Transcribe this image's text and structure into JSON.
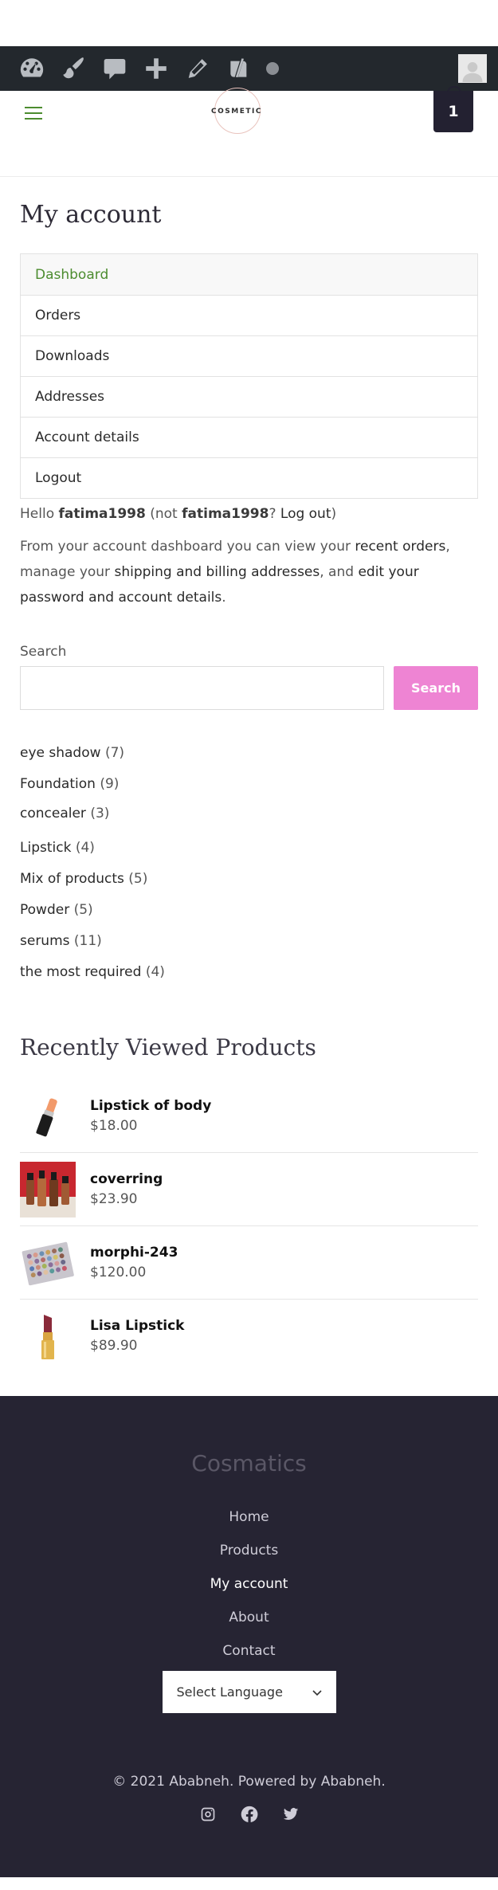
{
  "header": {
    "logo_text": "COSMETIC",
    "cart_count": "1"
  },
  "page": {
    "title": "My account"
  },
  "account_nav": {
    "items": [
      {
        "label": "Dashboard"
      },
      {
        "label": "Orders"
      },
      {
        "label": "Downloads"
      },
      {
        "label": "Addresses"
      },
      {
        "label": "Account details"
      },
      {
        "label": "Logout"
      }
    ]
  },
  "greeting": {
    "hello": "Hello",
    "username": "fatima1998",
    "not": "(not",
    "username2": "fatima1998",
    "question": "?",
    "logout_link": "Log out",
    "close": ")"
  },
  "intro": {
    "part1": "From your account dashboard you can view your",
    "link_orders": "recent orders",
    "part2": ", manage your",
    "link_addresses": "shipping and billing addresses",
    "part3": ", and",
    "link_account": "edit your password and account details",
    "part4": "."
  },
  "search": {
    "label": "Search",
    "value": "",
    "button": "Search"
  },
  "categories": [
    {
      "name": "eye shadow",
      "count": "(7)"
    },
    {
      "name": "Foundation",
      "count": "(9)"
    },
    {
      "name": "concealer",
      "count": "(3)"
    },
    {
      "name": "Lipstick",
      "count": "(4)"
    },
    {
      "name": "Mix of products",
      "count": "(5)"
    },
    {
      "name": "Powder",
      "count": "(5)"
    },
    {
      "name": "serums",
      "count": "(11)"
    },
    {
      "name": "the most required",
      "count": "(4)"
    }
  ],
  "recently_viewed": {
    "title": "Recently Viewed Products",
    "products": [
      {
        "name": "Lipstick of body",
        "price": "$18.00"
      },
      {
        "name": "coverring",
        "price": "$23.90"
      },
      {
        "name": "morphi-243",
        "price": "$120.00"
      },
      {
        "name": "Lisa Lipstick",
        "price": "$89.90"
      }
    ]
  },
  "footer": {
    "brand": "Cosmatics",
    "nav": [
      {
        "label": "Home"
      },
      {
        "label": "Products"
      },
      {
        "label": "My account"
      },
      {
        "label": "About"
      },
      {
        "label": "Contact"
      }
    ],
    "language_select": "Select Language",
    "copyright": "© 2021 Ababneh. Powered by Ababneh.",
    "social_icons": [
      "instagram-icon",
      "facebook-icon",
      "twitter-icon"
    ]
  },
  "colors": {
    "accent_green": "#4c8c2f",
    "search_button": "#ee84d3",
    "footer_bg": "#262433",
    "admin_bar": "#23282d"
  }
}
